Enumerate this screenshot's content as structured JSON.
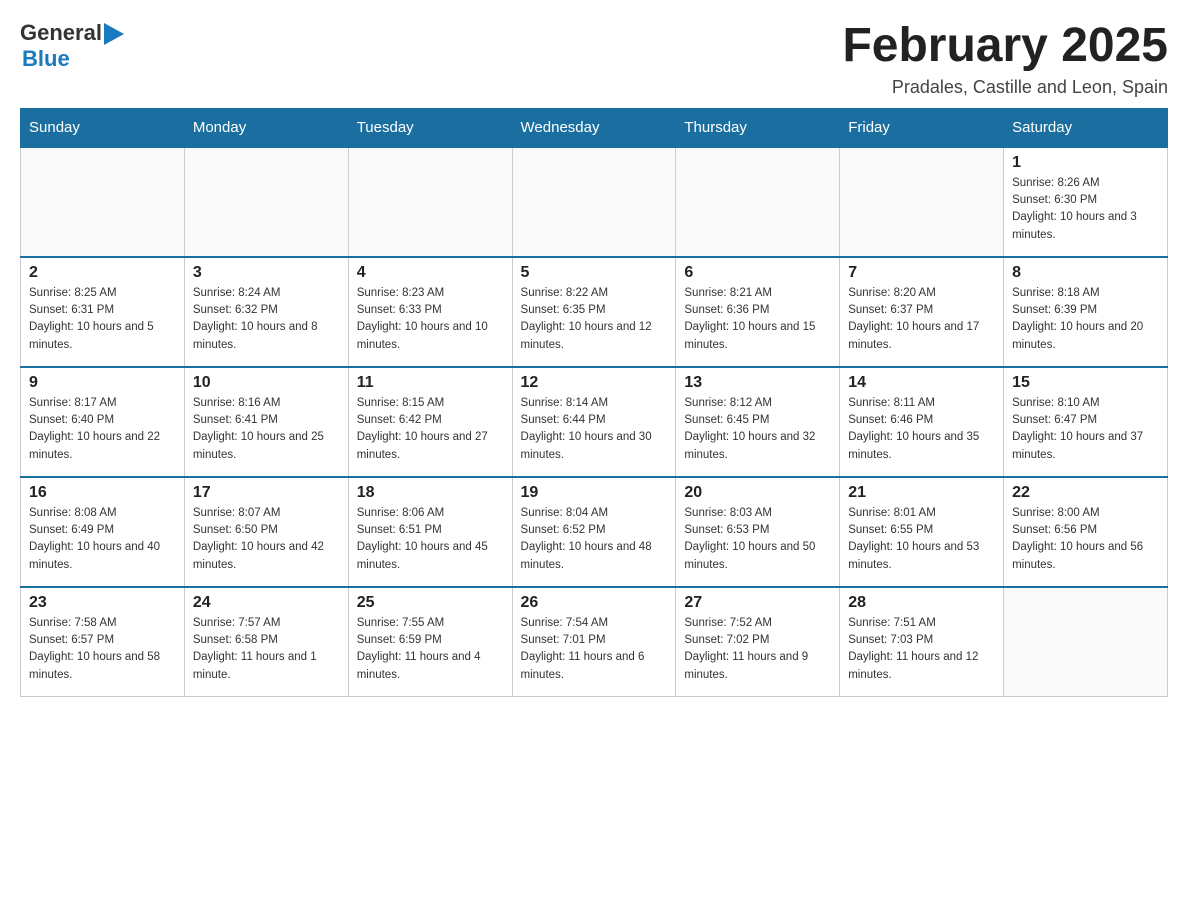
{
  "header": {
    "logo": {
      "text_general": "General",
      "text_blue": "Blue",
      "arrow": "▶"
    },
    "title": "February 2025",
    "subtitle": "Pradales, Castille and Leon, Spain"
  },
  "days_of_week": [
    "Sunday",
    "Monday",
    "Tuesday",
    "Wednesday",
    "Thursday",
    "Friday",
    "Saturday"
  ],
  "weeks": [
    [
      {
        "day": "",
        "info": ""
      },
      {
        "day": "",
        "info": ""
      },
      {
        "day": "",
        "info": ""
      },
      {
        "day": "",
        "info": ""
      },
      {
        "day": "",
        "info": ""
      },
      {
        "day": "",
        "info": ""
      },
      {
        "day": "1",
        "info": "Sunrise: 8:26 AM\nSunset: 6:30 PM\nDaylight: 10 hours and 3 minutes."
      }
    ],
    [
      {
        "day": "2",
        "info": "Sunrise: 8:25 AM\nSunset: 6:31 PM\nDaylight: 10 hours and 5 minutes."
      },
      {
        "day": "3",
        "info": "Sunrise: 8:24 AM\nSunset: 6:32 PM\nDaylight: 10 hours and 8 minutes."
      },
      {
        "day": "4",
        "info": "Sunrise: 8:23 AM\nSunset: 6:33 PM\nDaylight: 10 hours and 10 minutes."
      },
      {
        "day": "5",
        "info": "Sunrise: 8:22 AM\nSunset: 6:35 PM\nDaylight: 10 hours and 12 minutes."
      },
      {
        "day": "6",
        "info": "Sunrise: 8:21 AM\nSunset: 6:36 PM\nDaylight: 10 hours and 15 minutes."
      },
      {
        "day": "7",
        "info": "Sunrise: 8:20 AM\nSunset: 6:37 PM\nDaylight: 10 hours and 17 minutes."
      },
      {
        "day": "8",
        "info": "Sunrise: 8:18 AM\nSunset: 6:39 PM\nDaylight: 10 hours and 20 minutes."
      }
    ],
    [
      {
        "day": "9",
        "info": "Sunrise: 8:17 AM\nSunset: 6:40 PM\nDaylight: 10 hours and 22 minutes."
      },
      {
        "day": "10",
        "info": "Sunrise: 8:16 AM\nSunset: 6:41 PM\nDaylight: 10 hours and 25 minutes."
      },
      {
        "day": "11",
        "info": "Sunrise: 8:15 AM\nSunset: 6:42 PM\nDaylight: 10 hours and 27 minutes."
      },
      {
        "day": "12",
        "info": "Sunrise: 8:14 AM\nSunset: 6:44 PM\nDaylight: 10 hours and 30 minutes."
      },
      {
        "day": "13",
        "info": "Sunrise: 8:12 AM\nSunset: 6:45 PM\nDaylight: 10 hours and 32 minutes."
      },
      {
        "day": "14",
        "info": "Sunrise: 8:11 AM\nSunset: 6:46 PM\nDaylight: 10 hours and 35 minutes."
      },
      {
        "day": "15",
        "info": "Sunrise: 8:10 AM\nSunset: 6:47 PM\nDaylight: 10 hours and 37 minutes."
      }
    ],
    [
      {
        "day": "16",
        "info": "Sunrise: 8:08 AM\nSunset: 6:49 PM\nDaylight: 10 hours and 40 minutes."
      },
      {
        "day": "17",
        "info": "Sunrise: 8:07 AM\nSunset: 6:50 PM\nDaylight: 10 hours and 42 minutes."
      },
      {
        "day": "18",
        "info": "Sunrise: 8:06 AM\nSunset: 6:51 PM\nDaylight: 10 hours and 45 minutes."
      },
      {
        "day": "19",
        "info": "Sunrise: 8:04 AM\nSunset: 6:52 PM\nDaylight: 10 hours and 48 minutes."
      },
      {
        "day": "20",
        "info": "Sunrise: 8:03 AM\nSunset: 6:53 PM\nDaylight: 10 hours and 50 minutes."
      },
      {
        "day": "21",
        "info": "Sunrise: 8:01 AM\nSunset: 6:55 PM\nDaylight: 10 hours and 53 minutes."
      },
      {
        "day": "22",
        "info": "Sunrise: 8:00 AM\nSunset: 6:56 PM\nDaylight: 10 hours and 56 minutes."
      }
    ],
    [
      {
        "day": "23",
        "info": "Sunrise: 7:58 AM\nSunset: 6:57 PM\nDaylight: 10 hours and 58 minutes."
      },
      {
        "day": "24",
        "info": "Sunrise: 7:57 AM\nSunset: 6:58 PM\nDaylight: 11 hours and 1 minute."
      },
      {
        "day": "25",
        "info": "Sunrise: 7:55 AM\nSunset: 6:59 PM\nDaylight: 11 hours and 4 minutes."
      },
      {
        "day": "26",
        "info": "Sunrise: 7:54 AM\nSunset: 7:01 PM\nDaylight: 11 hours and 6 minutes."
      },
      {
        "day": "27",
        "info": "Sunrise: 7:52 AM\nSunset: 7:02 PM\nDaylight: 11 hours and 9 minutes."
      },
      {
        "day": "28",
        "info": "Sunrise: 7:51 AM\nSunset: 7:03 PM\nDaylight: 11 hours and 12 minutes."
      },
      {
        "day": "",
        "info": ""
      }
    ]
  ],
  "colors": {
    "header_bg": "#1a6fa0",
    "header_text": "#ffffff",
    "border": "#ccc",
    "title_color": "#222222"
  }
}
